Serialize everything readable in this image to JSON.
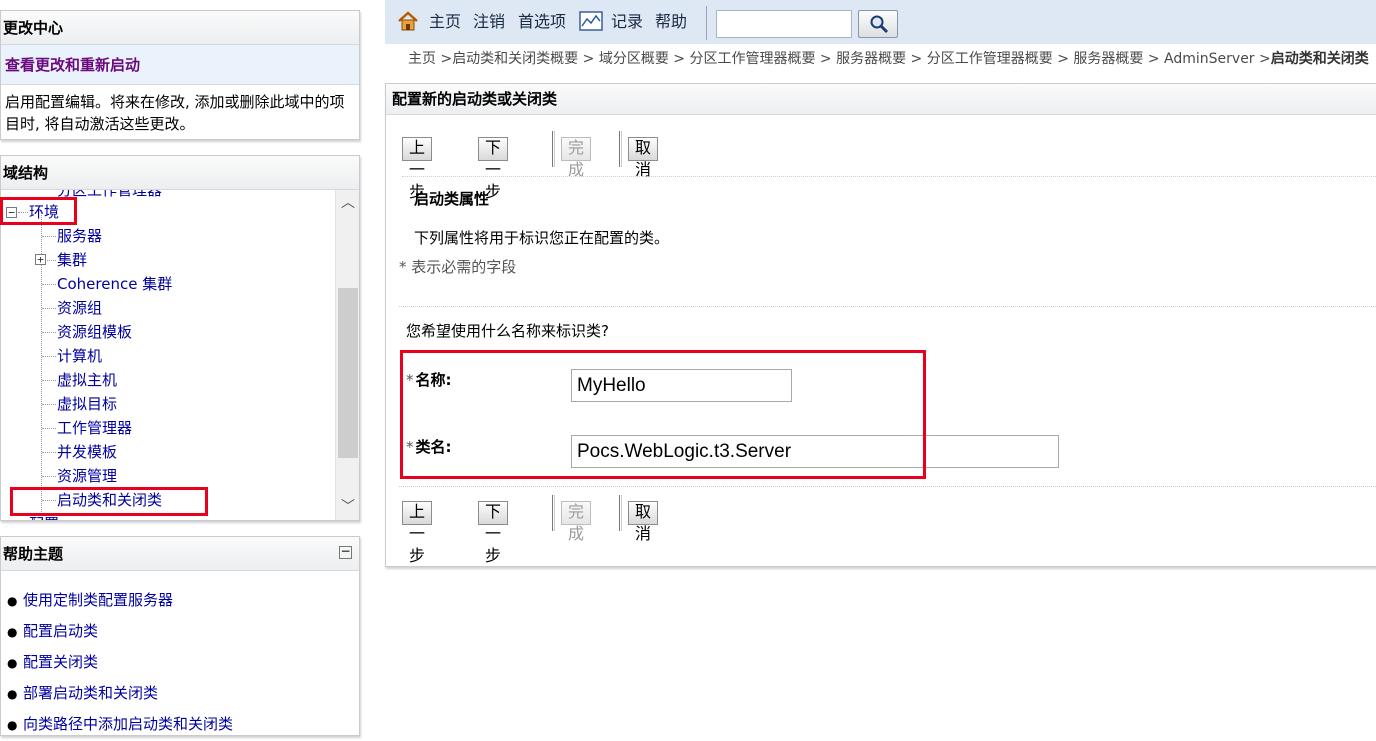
{
  "change_center": {
    "title": "更改中心",
    "link": "查看更改和重新启动",
    "description": "启用配置编辑。将来在修改, 添加或删除此域中的项目时, 将自动激活这些更改。"
  },
  "domain_structure": {
    "title": "域结构",
    "partial_top": "分区工作管理器",
    "environment": "环境",
    "items": [
      "服务器",
      "集群",
      "Coherence 集群",
      "资源组",
      "资源组模板",
      "计算机",
      "虚拟主机",
      "虚拟目标",
      "工作管理器",
      "并发模板",
      "资源管理",
      "启动类和关闭类"
    ],
    "partial_bottom": "配置"
  },
  "help_topics": {
    "title": "帮助主题",
    "items": [
      "使用定制类配置服务器",
      "配置启动类",
      "配置关闭类",
      "部署启动类和关闭类",
      "向类路径中添加启动类和关闭类"
    ]
  },
  "topbar": {
    "home": "主页",
    "logout": "注销",
    "preferences": "首选项",
    "record": "记录",
    "help": "帮助",
    "search_value": ""
  },
  "breadcrumb": {
    "items": [
      "主页 >",
      "启动类和关闭类概要 >",
      "域分区概要 >",
      "分区工作管理器概要 >",
      "服务器概要 >",
      "分区工作管理器概要 >",
      "服务器概要 >",
      "AdminServer >"
    ],
    "current": "启动类和关闭类"
  },
  "main": {
    "title": "配置新的启动类或关闭类",
    "buttons": {
      "back": "上一步",
      "next": "下一步",
      "finish": "完成",
      "cancel": "取消"
    },
    "section_title": "启动类属性",
    "description": "下列属性将用于标识您正在配置的类。",
    "required_note": "* 表示必需的字段",
    "question": "您希望使用什么名称来标识类?",
    "name_label": "名称:",
    "name_value": "MyHello",
    "classname_label": "类名:",
    "classname_value": "Pocs.WebLogic.t3.Server"
  },
  "colors": {
    "accent_red": "#e8001c",
    "topbar_bg": "#dde8f4",
    "link": "#00009e",
    "visited_link": "#6b0a7e"
  }
}
